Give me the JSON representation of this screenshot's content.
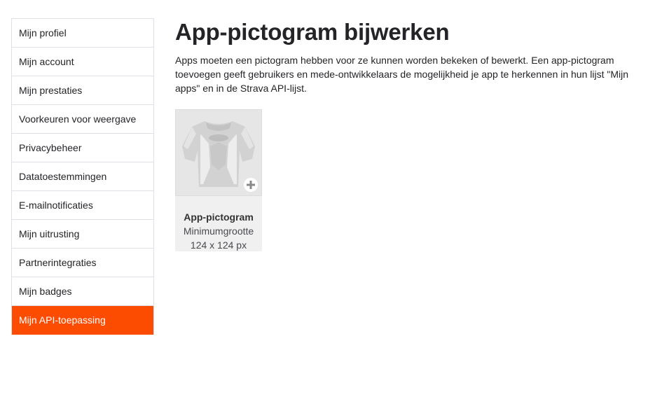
{
  "sidebar": {
    "items": [
      {
        "label": "Mijn profiel",
        "active": false
      },
      {
        "label": "Mijn account",
        "active": false
      },
      {
        "label": "Mijn prestaties",
        "active": false
      },
      {
        "label": "Voorkeuren voor weergave",
        "active": false
      },
      {
        "label": "Privacybeheer",
        "active": false
      },
      {
        "label": "Datatoestemmingen",
        "active": false
      },
      {
        "label": "E-mailnotificaties",
        "active": false
      },
      {
        "label": "Mijn uitrusting",
        "active": false
      },
      {
        "label": "Partnerintegraties",
        "active": false
      },
      {
        "label": "Mijn badges",
        "active": false
      },
      {
        "label": "Mijn API-toepassing",
        "active": true
      }
    ]
  },
  "main": {
    "title": "App-pictogram bijwerken",
    "description": "Apps moeten een pictogram hebben voor ze kunnen worden bekeken of bewerkt. Een app-pictogram toevoegen geeft gebruikers en mede-ontwikkelaars de mogelijkheid je app te herkennen in hun lijst \"Mijn apps\" en in de Strava API-lijst.",
    "uploader": {
      "title": "App-pictogram",
      "min_size_label": "Minimumgrootte",
      "min_size_value": "124 x 124 px",
      "placeholder_icon": "jersey-icon",
      "add_icon": "plus-icon"
    }
  },
  "colors": {
    "accent": "#fc4c02",
    "text": "#242428",
    "border": "#dfdfe8"
  }
}
